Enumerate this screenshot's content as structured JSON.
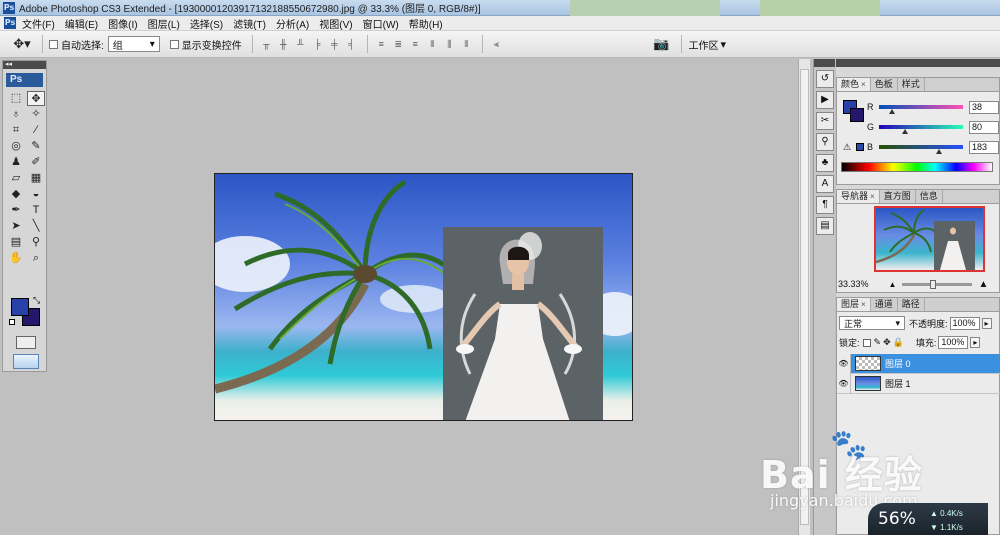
{
  "window": {
    "title": "Adobe Photoshop CS3 Extended - [19300001203917132188550672980.jpg @ 33.3% (图层 0, RGB/8#)]",
    "ps_icon": "Ps"
  },
  "menu": [
    "文件(F)",
    "编辑(E)",
    "图像(I)",
    "图层(L)",
    "选择(S)",
    "滤镜(T)",
    "分析(A)",
    "视图(V)",
    "窗口(W)",
    "帮助(H)"
  ],
  "options": {
    "auto_select_label": "自动选择:",
    "auto_select_value": "组",
    "show_transform_label": "显示变换控件",
    "workspace_label": "工作区"
  },
  "toolbox": {
    "logo": "Ps",
    "tools": [
      {
        "name": "marquee-icon",
        "glyph": "⬚"
      },
      {
        "name": "move-icon",
        "glyph": "✥"
      },
      {
        "name": "lasso-icon",
        "glyph": "♁"
      },
      {
        "name": "magic-wand-icon",
        "glyph": "✧"
      },
      {
        "name": "crop-icon",
        "glyph": "⌗"
      },
      {
        "name": "slice-icon",
        "glyph": "⁄"
      },
      {
        "name": "spot-heal-icon",
        "glyph": "◎"
      },
      {
        "name": "brush-icon",
        "glyph": "✎"
      },
      {
        "name": "stamp-icon",
        "glyph": "♟"
      },
      {
        "name": "history-brush-icon",
        "glyph": "✐"
      },
      {
        "name": "eraser-icon",
        "glyph": "▱"
      },
      {
        "name": "gradient-icon",
        "glyph": "▦"
      },
      {
        "name": "blur-icon",
        "glyph": "◆"
      },
      {
        "name": "dodge-icon",
        "glyph": "◒"
      },
      {
        "name": "pen-icon",
        "glyph": "✒"
      },
      {
        "name": "type-icon",
        "glyph": "T"
      },
      {
        "name": "path-select-icon",
        "glyph": "➤"
      },
      {
        "name": "line-icon",
        "glyph": "╲"
      },
      {
        "name": "notes-icon",
        "glyph": "▤"
      },
      {
        "name": "eyedropper-icon",
        "glyph": "⚲"
      },
      {
        "name": "hand-icon",
        "glyph": "✋"
      },
      {
        "name": "zoom-icon",
        "glyph": "⌕"
      }
    ]
  },
  "color_panel": {
    "tabs": [
      "颜色",
      "色板",
      "样式"
    ],
    "r_label": "R",
    "r_value": "38",
    "r_level": 0.15,
    "g_label": "G",
    "g_value": "80",
    "g_level": 0.31,
    "b_label": "B",
    "b_value": "183",
    "b_level": 0.72,
    "warning_icon": "⚠"
  },
  "navigator_panel": {
    "tabs": [
      "导航器",
      "直方图",
      "信息"
    ],
    "zoom": "33.33%"
  },
  "layers_panel": {
    "tabs": [
      "图层",
      "通道",
      "路径"
    ],
    "blend_mode": "正常",
    "opacity_label": "不透明度:",
    "opacity_value": "100%",
    "lock_label": "锁定:",
    "fill_label": "填充:",
    "fill_value": "100%",
    "layers": [
      {
        "name": "图层 0",
        "selected": true
      },
      {
        "name": "图层 1",
        "selected": false
      }
    ]
  },
  "watermark": {
    "brand": "Bai  经验",
    "url": "jingyan.baidu.com"
  },
  "net_meter": {
    "percent": "56%",
    "up": "0.4K/s",
    "down": "1.1K/s"
  }
}
